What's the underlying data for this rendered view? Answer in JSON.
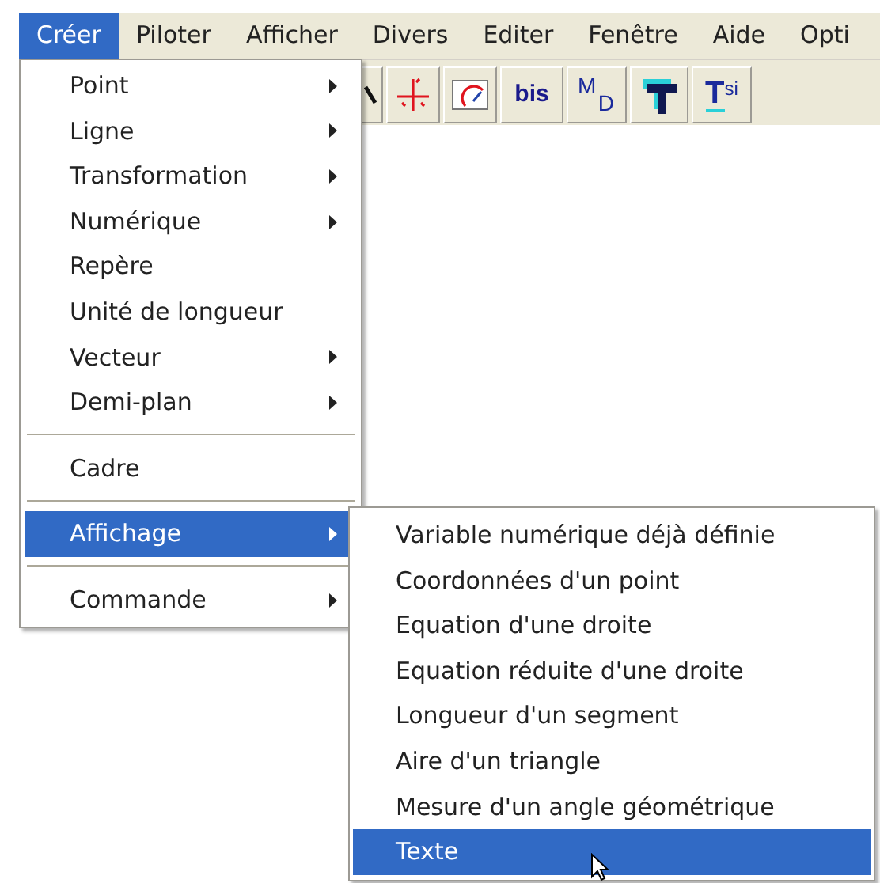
{
  "menubar": [
    {
      "label": "Créer",
      "selected": true
    },
    {
      "label": "Piloter",
      "selected": false
    },
    {
      "label": "Afficher",
      "selected": false
    },
    {
      "label": "Divers",
      "selected": false
    },
    {
      "label": "Editer",
      "selected": false
    },
    {
      "label": "Fenêtre",
      "selected": false
    },
    {
      "label": "Aide",
      "selected": false
    },
    {
      "label": "Opti",
      "selected": false
    }
  ],
  "toolbar": [
    {
      "kind": "partial"
    },
    {
      "kind": "axes"
    },
    {
      "kind": "gauge"
    },
    {
      "kind": "text",
      "label": "bis"
    },
    {
      "kind": "md",
      "label": "M",
      "sublabel": "D"
    },
    {
      "kind": "bigt"
    },
    {
      "kind": "tsi",
      "label": "T",
      "sublabel": "si"
    }
  ],
  "menu": [
    {
      "kind": "item",
      "label": "Point",
      "submenu": true,
      "selected": false
    },
    {
      "kind": "item",
      "label": "Ligne",
      "submenu": true,
      "selected": false
    },
    {
      "kind": "item",
      "label": "Transformation",
      "submenu": true,
      "selected": false
    },
    {
      "kind": "item",
      "label": "Numérique",
      "submenu": true,
      "selected": false
    },
    {
      "kind": "item",
      "label": "Repère",
      "submenu": false,
      "selected": false
    },
    {
      "kind": "item",
      "label": "Unité de longueur",
      "submenu": false,
      "selected": false
    },
    {
      "kind": "item",
      "label": "Vecteur",
      "submenu": true,
      "selected": false
    },
    {
      "kind": "item",
      "label": "Demi-plan",
      "submenu": true,
      "selected": false
    },
    {
      "kind": "separator"
    },
    {
      "kind": "item",
      "label": "Cadre",
      "submenu": false,
      "selected": false
    },
    {
      "kind": "separator"
    },
    {
      "kind": "item",
      "label": "Affichage",
      "submenu": true,
      "selected": true
    },
    {
      "kind": "separator"
    },
    {
      "kind": "item",
      "label": "Commande",
      "submenu": true,
      "selected": false
    }
  ],
  "submenu": [
    {
      "label": "Variable numérique déjà définie",
      "selected": false
    },
    {
      "label": "Coordonnées d'un point",
      "selected": false
    },
    {
      "label": "Equation d'une droite",
      "selected": false
    },
    {
      "label": "Equation réduite d'une droite",
      "selected": false
    },
    {
      "label": "Longueur d'un segment",
      "selected": false
    },
    {
      "label": "Aire d'un triangle",
      "selected": false
    },
    {
      "label": "Mesure d'un angle géométrique",
      "selected": false
    },
    {
      "label": "Texte",
      "selected": true
    }
  ]
}
